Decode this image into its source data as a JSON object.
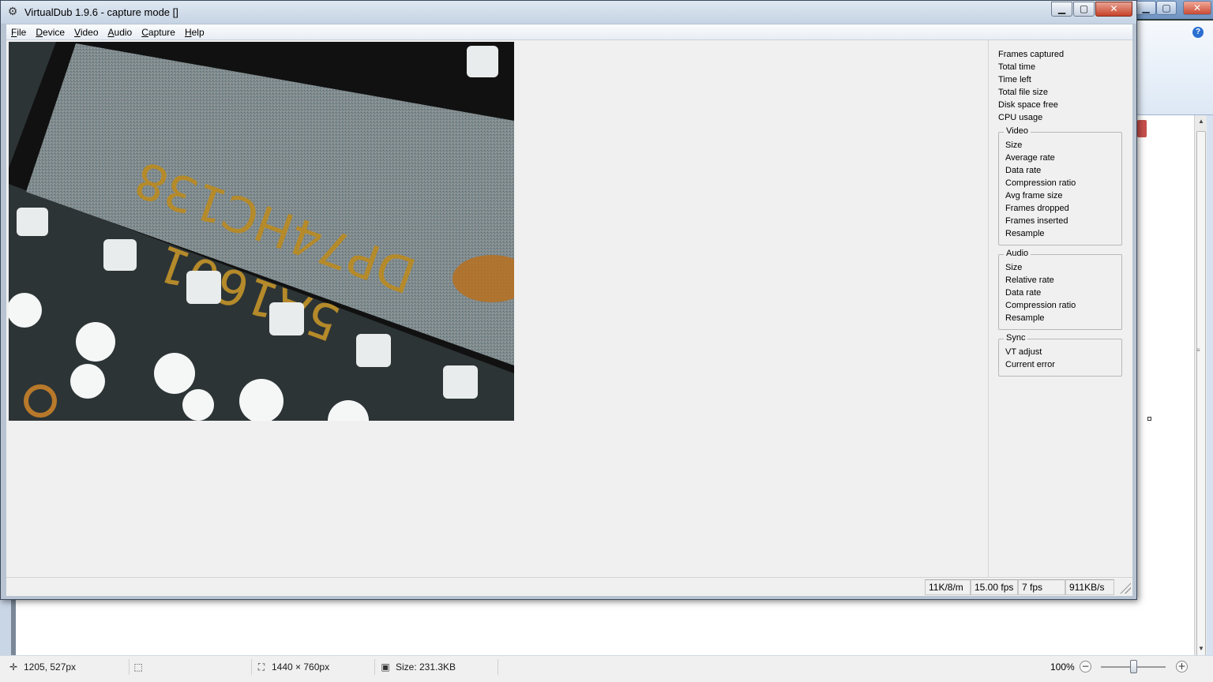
{
  "vd_window": {
    "title": "VirtualDub 1.9.6 - capture mode []",
    "controls": {
      "minimize": "▁",
      "maximize": "▢",
      "close": "✕"
    },
    "menu": [
      "File",
      "Device",
      "Video",
      "Audio",
      "Capture",
      "Help"
    ],
    "preview": {
      "description_text": [
        "DP74HC138",
        "5A1601"
      ]
    },
    "stats": {
      "top": [
        "Frames captured",
        "Total time",
        "Time left",
        "Total file size",
        "Disk space free",
        "CPU usage"
      ],
      "video": {
        "title": "Video",
        "items": [
          "Size",
          "Average rate",
          "Data rate",
          "Compression ratio",
          "Avg frame size",
          "Frames dropped",
          "Frames inserted",
          "Resample"
        ]
      },
      "audio": {
        "title": "Audio",
        "items": [
          "Size",
          "Relative rate",
          "Data rate",
          "Compression ratio",
          "Resample"
        ]
      },
      "sync": {
        "title": "Sync",
        "items": [
          "VT adjust",
          "Current error"
        ]
      }
    },
    "status": [
      "11K/8/m",
      "15.00 fps",
      "7 fps",
      "911KB/s"
    ]
  },
  "bg_window": {
    "controls": {
      "minimize": "▁",
      "maximize": "▢",
      "close": "✕"
    },
    "help": "?",
    "status": {
      "cursor": "1205, 527px",
      "dimensions": "1440 × 760px",
      "size": "Size: 231.3KB",
      "zoom": "100%",
      "zoom_out": "−",
      "zoom_in": "+",
      "zoom_fraction": 0.5
    }
  }
}
